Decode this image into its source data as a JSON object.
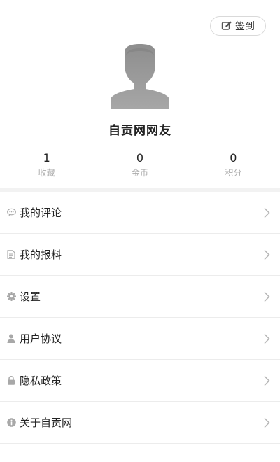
{
  "header": {
    "checkin_label": "签到",
    "username": "自贡网网友"
  },
  "stats": [
    {
      "value": "1",
      "label": "收藏"
    },
    {
      "value": "0",
      "label": "金币"
    },
    {
      "value": "0",
      "label": "积分"
    }
  ],
  "menu": [
    {
      "label": "我的评论",
      "icon": "comment-icon"
    },
    {
      "label": "我的报料",
      "icon": "document-icon"
    },
    {
      "label": "设置",
      "icon": "gear-icon"
    },
    {
      "label": "用户协议",
      "icon": "user-icon"
    },
    {
      "label": "隐私政策",
      "icon": "lock-icon"
    },
    {
      "label": "关于自贡网",
      "icon": "info-icon"
    }
  ],
  "colors": {
    "icon_gray": "#a8a8a8",
    "chevron": "#b5b5b5",
    "avatar_gray": "#9a9a9a"
  }
}
